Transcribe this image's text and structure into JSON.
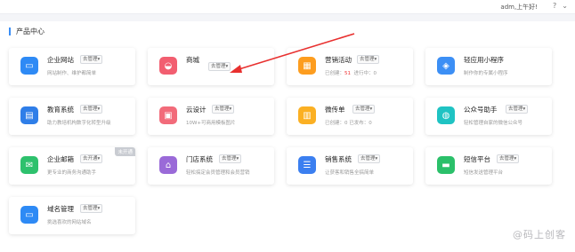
{
  "header": {
    "greeting": "adm,上午好!",
    "icons": [
      "help-icon",
      "user-icon"
    ]
  },
  "section": {
    "title": "产品中心"
  },
  "cards": [
    {
      "name": "企业网站",
      "tag": "去管理",
      "desc": "网站制作、维护都简单",
      "color": "#2e8af5",
      "icon": "website-icon"
    },
    {
      "name": "商城",
      "tag": "去管理",
      "desc": "",
      "color": "#f25e70",
      "icon": "shop-icon"
    },
    {
      "name": "营销活动",
      "tag": "去管理",
      "desc_prefix": "已创建：",
      "desc_value": "51",
      "desc_suffix": "进行中：0",
      "color": "#fd9d1f",
      "icon": "marketing-icon"
    },
    {
      "name": "轻应用小程序",
      "tag": "",
      "desc": "制作你的专属小程序",
      "color": "#3c8ff5",
      "icon": "miniapp-icon"
    },
    {
      "name": "教育系统",
      "tag": "去管理",
      "desc": "助力教培机构数字化转型升级",
      "color": "#2f7ee8",
      "icon": "education-icon"
    },
    {
      "name": "云设计",
      "tag": "去管理",
      "desc": "10W+可商用模板图片",
      "color": "#f26b7a",
      "icon": "design-icon"
    },
    {
      "name": "微传单",
      "tag": "去管理",
      "desc": "已创建：0    已发布：0",
      "color": "#fbb023",
      "icon": "flyer-icon"
    },
    {
      "name": "公众号助手",
      "tag": "去管理",
      "desc": "轻松管理自家的微信公众号",
      "color": "#1fc3c3",
      "icon": "wechat-icon"
    },
    {
      "name": "企业邮箱",
      "tag": "去开通",
      "desc": "更专业的商务沟通助手",
      "color": "#2ec16d",
      "icon": "mail-icon",
      "ribbon": "未开通"
    },
    {
      "name": "门店系统",
      "tag": "去管理",
      "desc": "轻松搞定会员管理和会员营销",
      "color": "#9a6ad8",
      "icon": "store-icon"
    },
    {
      "name": "销售系统",
      "tag": "去管理",
      "desc": "让获客和销售全搞简单",
      "color": "#3b7ff0",
      "icon": "sales-icon"
    },
    {
      "name": "短信平台",
      "tag": "去管理",
      "desc": "短信发送管理平台",
      "color": "#2bc06a",
      "icon": "sms-icon"
    },
    {
      "name": "域名管理",
      "tag": "去管理",
      "desc": "挑选喜欢的网站域名",
      "color": "#2e8af5",
      "icon": "domain-icon"
    }
  ],
  "watermark": "@码上创客"
}
